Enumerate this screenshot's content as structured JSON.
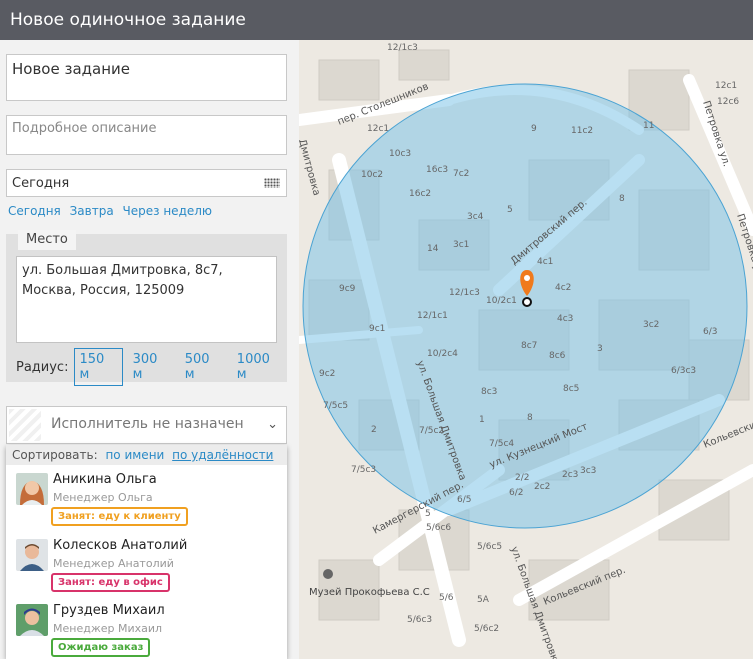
{
  "header": {
    "title": "Новое одиночное задание"
  },
  "form": {
    "title_value": "Новое задание",
    "description_placeholder": "Подробное описание",
    "date_value": "Сегодня",
    "quick_dates": [
      "Сегодня",
      "Завтра",
      "Через неделю"
    ],
    "place_label": "Место",
    "address": "ул. Большая Дмитровка, 8с7, Москва, Россия, 125009",
    "radius_label": "Радиус:",
    "radius_options": [
      "150 м",
      "300 м",
      "500 м",
      "1000 м"
    ],
    "radius_selected": "150 м"
  },
  "assignee": {
    "placeholder": "Исполнитель не назначен",
    "sort_label": "Сортировать:",
    "sort_by_name": "по имени",
    "sort_by_distance": "по удалённости",
    "people": [
      {
        "name": "Аникина Ольга",
        "role": "Менеджер Ольга",
        "status": "Занят: еду к клиенту",
        "status_color": "#f0a020"
      },
      {
        "name": "Колесков Анатолий",
        "role": "Менеджер Анатолий",
        "status": "Занят: еду в офис",
        "status_color": "#d8336a"
      },
      {
        "name": "Груздев Михаил",
        "role": "Менеджер Михаил",
        "status": "Ожидаю заказ",
        "status_color": "#4aaa3c"
      }
    ]
  },
  "map": {
    "circle_color": "#7fc4e8",
    "marker_color": "#f07a1c",
    "street_labels": [
      "пер. Столешников",
      "Дмитровка",
      "Дмитровский пер.",
      "ул. Большая Дмитровка",
      "ул. Кузнецкий Мост",
      "Камергерский пер.",
      "Кольевский пер.",
      "Кольевски",
      "Петровка ул.",
      "Петровка ул.",
      "ул. Большая Дмитровка"
    ],
    "building_labels": [
      "12с1",
      "11с2",
      "11",
      "9",
      "10с3",
      "10с2",
      "16с3",
      "7с2",
      "16с2",
      "5",
      "8",
      "3с4",
      "14",
      "3с1",
      "4с1",
      "9с9",
      "12/1с3",
      "4с2",
      "12/1с1",
      "10/2с1",
      "4с3",
      "3с2",
      "9с1",
      "8с7",
      "8с6",
      "3",
      "6/3",
      "9с2",
      "10/2с4",
      "8с3",
      "8с5",
      "6/3с3",
      "7/5с5",
      "8",
      "2",
      "7/5с4",
      "7/5с2",
      "1",
      "7/5с3",
      "2с3",
      "3с3",
      "2/2",
      "6/2",
      "2с2",
      "5",
      "6/5",
      "5/6с6",
      "5/6с5",
      "5/6",
      "5А",
      "5/6с3",
      "5/6с2",
      "12с1",
      "12с6",
      "12/1с3"
    ],
    "poi_label": "Музей Прокофьева С.С"
  }
}
